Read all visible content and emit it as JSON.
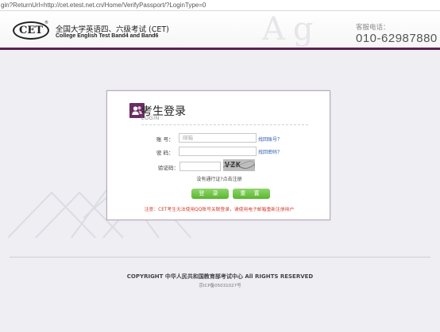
{
  "browser": {
    "url": "gin?ReturnUrl=http://cet.etest.net.cn/Home/VerifyPassport/?LoginType=0"
  },
  "header": {
    "logo_text": "CET",
    "logo_reg": "®",
    "title_cn": "全国大学英语四、六级考试 (CET)",
    "title_en": "College English Test Band4 and Band6",
    "hotline_label": "客服电话：",
    "hotline_number": "010-62987880",
    "accent_color": "#5b2350"
  },
  "login": {
    "title": "考生登录",
    "subtitle": "LOGIN",
    "account_label": "账  号：",
    "account_placeholder": "邮箱",
    "forgot_account": "找回账号？",
    "password_label": "密  码：",
    "password_placeholder": "",
    "forgot_password": "找回密码？",
    "captcha_label": "验证码：",
    "captcha_text": "VZK",
    "register_prompt": "没有通行证?点击注册",
    "login_button": "登 录",
    "reset_button": "重 置",
    "notice": "注意：CET考生无法使用QQ账号关联登录，请使用电子邮箱重新注册用户"
  },
  "footer": {
    "copyright": "COPYRIGHT 中华人民共和国教育部考试中心 All RIGHTS RESERVED",
    "icp": "京ICP备05031027号"
  }
}
